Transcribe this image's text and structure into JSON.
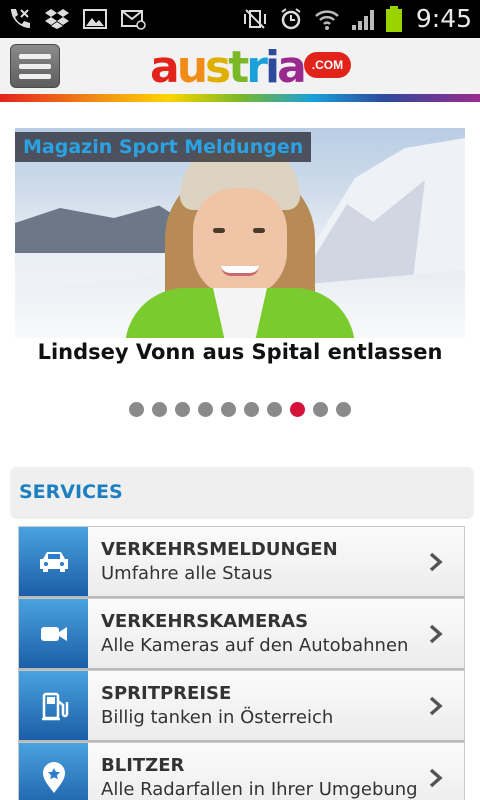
{
  "status_bar": {
    "time": "9:45"
  },
  "header": {
    "logo_text": "austria",
    "logo_badge": ".COM"
  },
  "slider": {
    "category_label": "Magazin Sport Meldungen",
    "caption": "Lindsey Vonn aus Spital entlassen",
    "dot_count": 10,
    "active_dot": 8
  },
  "services": {
    "heading": "SERVICES",
    "items": [
      {
        "title": "VERKEHRSMELDUNGEN",
        "subtitle": "Umfahre alle Staus",
        "icon": "car-icon"
      },
      {
        "title": "VERKEHRSKAMERAS",
        "subtitle": "Alle Kameras auf den Autobahnen",
        "icon": "video-camera-icon"
      },
      {
        "title": "SPRITPREISE",
        "subtitle": "Billig tanken in Österreich",
        "icon": "fuel-pump-icon"
      },
      {
        "title": "BLITZER",
        "subtitle": "Alle Radarfallen in Ihrer Umgebung",
        "icon": "map-pin-icon"
      }
    ]
  },
  "colors": {
    "accent_blue": "#1c7fbf",
    "active_dot": "#d6123b",
    "icon_blue": "#2a7ccc"
  }
}
